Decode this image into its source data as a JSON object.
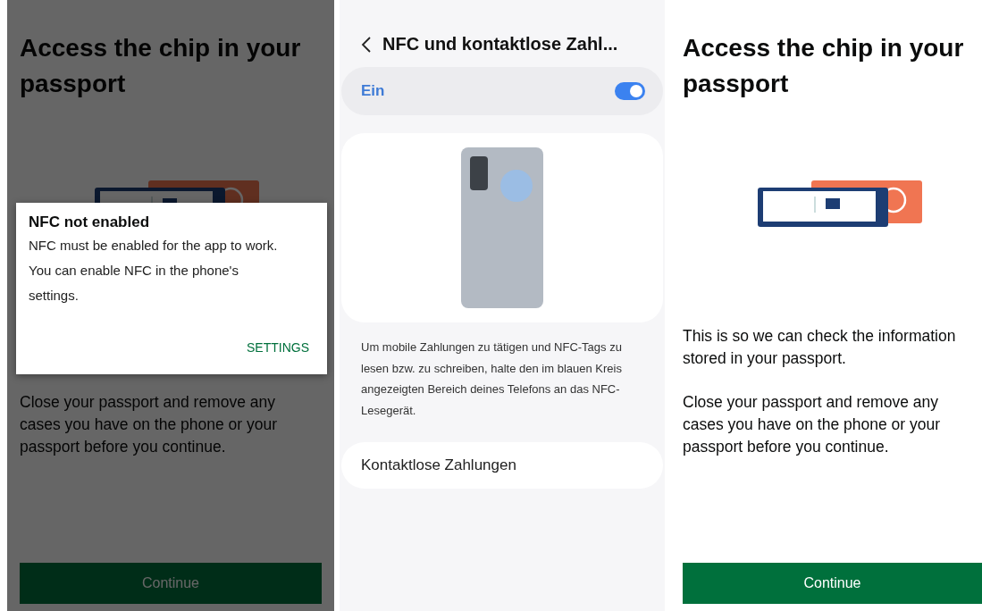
{
  "screens": [
    {
      "kind": "app",
      "heading": "Access the chip in your passport",
      "paragraphs": [
        "Close your passport and remove any cases you have on the phone or your passport before you continue."
      ],
      "button": {
        "label": "Continue"
      },
      "dialog": {
        "title": "NFC not enabled",
        "body": "NFC must be enabled for the app to work. You can enable NFC in the phone's settings.",
        "action": "SETTINGS"
      }
    },
    {
      "kind": "settings",
      "title": "NFC und kontaktlose Zahl...",
      "toggle": {
        "label": "Ein",
        "on": true
      },
      "description": "Um mobile Zahlungen zu tätigen und NFC-Tags zu lesen bzw. zu schreiben, halte den im blauen Kreis angezeigten Bereich deines Telefons an das NFC-Lesegerät.",
      "items": [
        "Kontaktlose Zahlungen"
      ]
    },
    {
      "kind": "app",
      "heading": "Access the chip in your passport",
      "paragraphs": [
        "This is so we can check the information stored in your passport.",
        "Close your passport and remove any cases you have on the phone or your passport before you continue."
      ],
      "button": {
        "label": "Continue"
      }
    }
  ]
}
